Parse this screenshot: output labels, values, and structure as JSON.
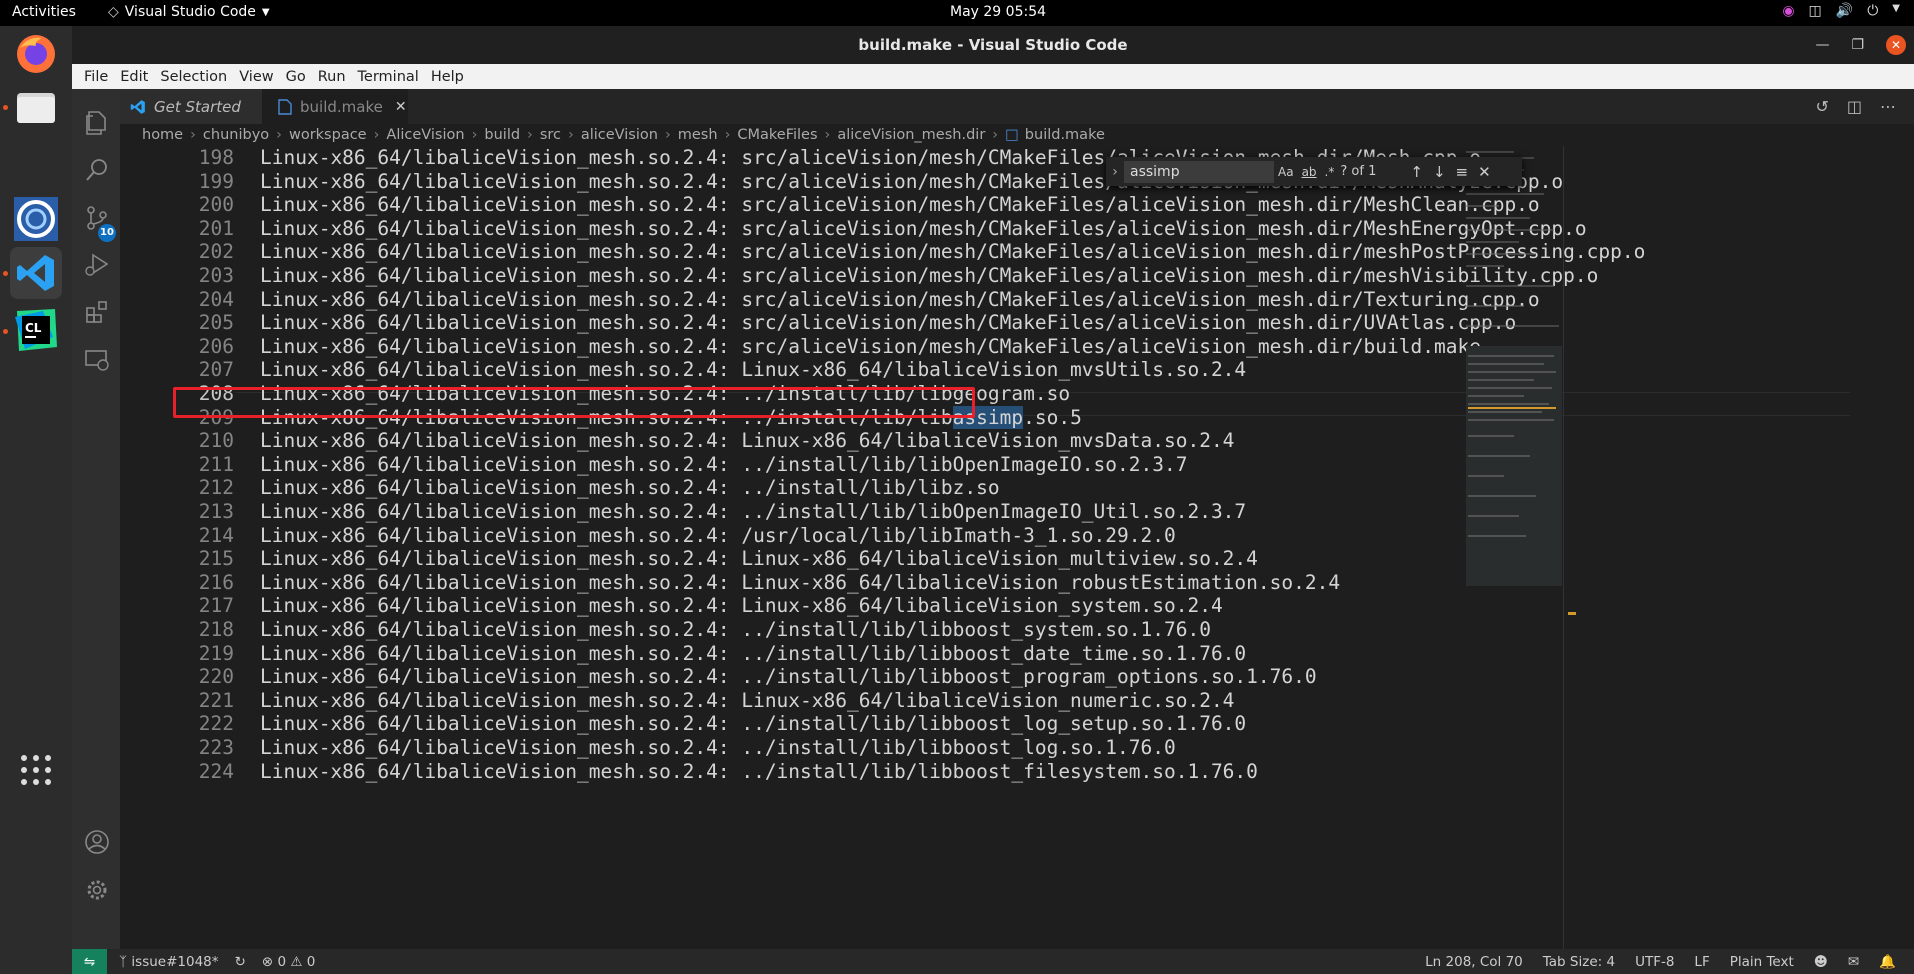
{
  "topbar": {
    "activities": "Activities",
    "app_name": "Visual Studio Code",
    "clock": "May 29  05:54"
  },
  "window": {
    "title": "build.make - Visual Studio Code"
  },
  "menu": [
    "File",
    "Edit",
    "Selection",
    "View",
    "Go",
    "Run",
    "Terminal",
    "Help"
  ],
  "activity": {
    "source_control_badge": "10"
  },
  "tabs": [
    {
      "label": "Get Started"
    },
    {
      "label": "build.make"
    }
  ],
  "breadcrumb": [
    "home",
    "chunibyo",
    "workspace",
    "AliceVision",
    "build",
    "src",
    "aliceVision",
    "mesh",
    "CMakeFiles",
    "aliceVision_mesh.dir",
    "build.make"
  ],
  "find": {
    "query": "assimp",
    "opt_case": "Aa",
    "opt_word": "ab",
    "opt_regex": ".*",
    "count": "? of 1"
  },
  "editor": {
    "current_line": "208",
    "highlight_line": "209",
    "highlight_prefix": "Linux-x86_64/libaliceVision_mesh.so.2.4: ../install/lib/lib",
    "highlight_match": "assimp",
    "highlight_suffix": ".so.5",
    "lines": [
      {
        "n": "198",
        "text": "Linux-x86_64/libaliceVision_mesh.so.2.4: src/aliceVision/mesh/CMakeFiles/aliceVision_mesh.dir/Mesh.cpp.o"
      },
      {
        "n": "199",
        "text": "Linux-x86_64/libaliceVision_mesh.so.2.4: src/aliceVision/mesh/CMakeFiles/aliceVision_mesh.dir/MeshAnalyze.cpp.o"
      },
      {
        "n": "200",
        "text": "Linux-x86_64/libaliceVision_mesh.so.2.4: src/aliceVision/mesh/CMakeFiles/aliceVision_mesh.dir/MeshClean.cpp.o"
      },
      {
        "n": "201",
        "text": "Linux-x86_64/libaliceVision_mesh.so.2.4: src/aliceVision/mesh/CMakeFiles/aliceVision_mesh.dir/MeshEnergyOpt.cpp.o"
      },
      {
        "n": "202",
        "text": "Linux-x86_64/libaliceVision_mesh.so.2.4: src/aliceVision/mesh/CMakeFiles/aliceVision_mesh.dir/meshPostProcessing.cpp.o"
      },
      {
        "n": "203",
        "text": "Linux-x86_64/libaliceVision_mesh.so.2.4: src/aliceVision/mesh/CMakeFiles/aliceVision_mesh.dir/meshVisibility.cpp.o"
      },
      {
        "n": "204",
        "text": "Linux-x86_64/libaliceVision_mesh.so.2.4: src/aliceVision/mesh/CMakeFiles/aliceVision_mesh.dir/Texturing.cpp.o"
      },
      {
        "n": "205",
        "text": "Linux-x86_64/libaliceVision_mesh.so.2.4: src/aliceVision/mesh/CMakeFiles/aliceVision_mesh.dir/UVAtlas.cpp.o"
      },
      {
        "n": "206",
        "text": "Linux-x86_64/libaliceVision_mesh.so.2.4: src/aliceVision/mesh/CMakeFiles/aliceVision_mesh.dir/build.make"
      },
      {
        "n": "207",
        "text": "Linux-x86_64/libaliceVision_mesh.so.2.4: Linux-x86_64/libaliceVision_mvsUtils.so.2.4"
      },
      {
        "n": "208",
        "text": "Linux-x86_64/libaliceVision_mesh.so.2.4: ../install/lib/libgeogram.so"
      },
      {
        "n": "210",
        "text": "Linux-x86_64/libaliceVision_mesh.so.2.4: Linux-x86_64/libaliceVision_mvsData.so.2.4"
      },
      {
        "n": "211",
        "text": "Linux-x86_64/libaliceVision_mesh.so.2.4: ../install/lib/libOpenImageIO.so.2.3.7"
      },
      {
        "n": "212",
        "text": "Linux-x86_64/libaliceVision_mesh.so.2.4: ../install/lib/libz.so"
      },
      {
        "n": "213",
        "text": "Linux-x86_64/libaliceVision_mesh.so.2.4: ../install/lib/libOpenImageIO_Util.so.2.3.7"
      },
      {
        "n": "214",
        "text": "Linux-x86_64/libaliceVision_mesh.so.2.4: /usr/local/lib/libImath-3_1.so.29.2.0"
      },
      {
        "n": "215",
        "text": "Linux-x86_64/libaliceVision_mesh.so.2.4: Linux-x86_64/libaliceVision_multiview.so.2.4"
      },
      {
        "n": "216",
        "text": "Linux-x86_64/libaliceVision_mesh.so.2.4: Linux-x86_64/libaliceVision_robustEstimation.so.2.4"
      },
      {
        "n": "217",
        "text": "Linux-x86_64/libaliceVision_mesh.so.2.4: Linux-x86_64/libaliceVision_system.so.2.4"
      },
      {
        "n": "218",
        "text": "Linux-x86_64/libaliceVision_mesh.so.2.4: ../install/lib/libboost_system.so.1.76.0"
      },
      {
        "n": "219",
        "text": "Linux-x86_64/libaliceVision_mesh.so.2.4: ../install/lib/libboost_date_time.so.1.76.0"
      },
      {
        "n": "220",
        "text": "Linux-x86_64/libaliceVision_mesh.so.2.4: ../install/lib/libboost_program_options.so.1.76.0"
      },
      {
        "n": "221",
        "text": "Linux-x86_64/libaliceVision_mesh.so.2.4: Linux-x86_64/libaliceVision_numeric.so.2.4"
      },
      {
        "n": "222",
        "text": "Linux-x86_64/libaliceVision_mesh.so.2.4: ../install/lib/libboost_log_setup.so.1.76.0"
      },
      {
        "n": "223",
        "text": "Linux-x86_64/libaliceVision_mesh.so.2.4: ../install/lib/libboost_log.so.1.76.0"
      },
      {
        "n": "224",
        "text": "Linux-x86_64/libaliceVision_mesh.so.2.4: ../install/lib/libboost_filesystem.so.1.76.0"
      }
    ]
  },
  "status": {
    "branch": "issue#1048*",
    "errors": "0",
    "warnings": "0",
    "position": "Ln 208, Col 70",
    "tab_size": "Tab Size: 4",
    "encoding": "UTF-8",
    "eol": "LF",
    "language": "Plain Text"
  },
  "colors": {
    "highlight_box": "#e8202a",
    "remote_indicator": "#16825d",
    "badge": "#0e70c0"
  }
}
